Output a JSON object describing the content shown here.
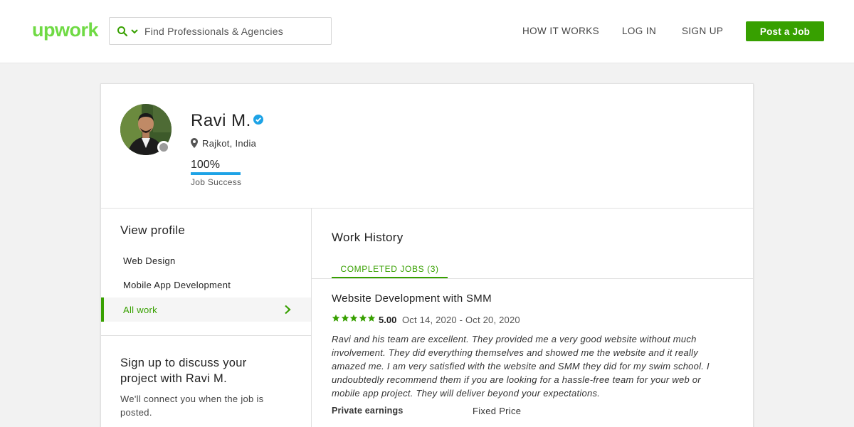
{
  "header": {
    "logo_text": "upwork",
    "search_placeholder": "Find Professionals & Agencies",
    "nav": [
      "HOW IT WORKS",
      "LOG IN",
      "SIGN UP"
    ],
    "post_job_label": "Post a Job"
  },
  "profile": {
    "name": "Ravi M.",
    "location": "Rajkot, India",
    "job_success_value": "100%",
    "job_success_fraction": 1.0,
    "job_success_label": "Job Success"
  },
  "sidebar": {
    "title": "View profile",
    "items": [
      {
        "label": "Web Design"
      },
      {
        "label": "Mobile App Development"
      },
      {
        "label": "All work",
        "active": true
      }
    ],
    "signup_title": "Sign up to discuss your project with Ravi M.",
    "signup_text": "We'll connect you when the job is posted."
  },
  "work_history": {
    "title": "Work History",
    "tab_label": "COMPLETED JOBS (3)",
    "job": {
      "title": "Website Development with SMM",
      "stars": 5,
      "rating": "5.00",
      "dates": "Oct 14, 2020 - Oct 20, 2020",
      "review": "Ravi and his team are excellent. They provided me a very good website without much involvement. They did everything themselves and showed me the website and it really amazed me. I am very satisfied with the website and SMM they did for my swim school. I undoubtedly recommend them if you are looking for a hassle-free team for your web or mobile app project. They will deliver beyond your expectations.",
      "earnings_label": "Private earnings",
      "price_type": "Fixed Price"
    }
  },
  "colors": {
    "brand_green": "#37a000",
    "job_success_blue": "#1ea3e6",
    "verified_blue": "#1ea3e6",
    "status_gray": "#9b9b9b"
  }
}
